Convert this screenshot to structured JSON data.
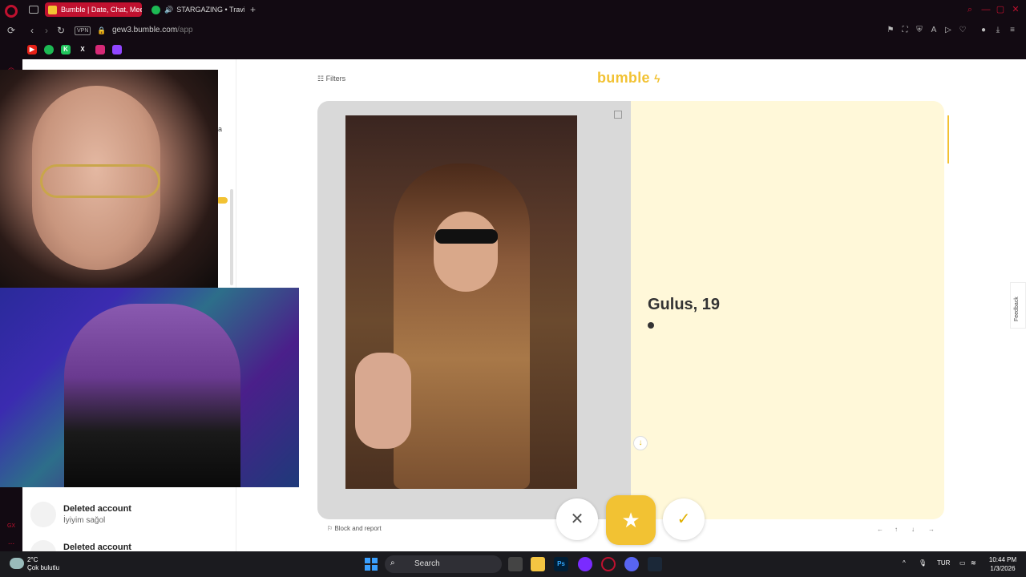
{
  "browser": {
    "tabs": [
      {
        "title": "Bumble | Date, Chat, Mee",
        "active": true
      },
      {
        "title": "STARGAZING • Travis",
        "active": false
      }
    ],
    "new_tab": "+",
    "vpn_label": "VPN",
    "url": {
      "host": "gew3.bumble.com",
      "path": "/app"
    },
    "bookmarks": [
      "youtube-icon",
      "spotify-icon",
      "kick-icon",
      "x-icon",
      "instagram-icon",
      "twitch-icon"
    ]
  },
  "opera_sidebar": {
    "icons": [
      "opera-logo-icon",
      "speed-dial-icon",
      "gx-icon",
      "more-icon"
    ],
    "gx_label": "GX",
    "more_label": "..."
  },
  "left_pane": {
    "matches": [
      {
        "name": "Deleted account",
        "message": "İyiyim sağol"
      },
      {
        "name": "Deleted account",
        "message": ""
      }
    ],
    "partial_text": "a"
  },
  "header": {
    "filters_label": "Filters",
    "logo": "bumble"
  },
  "profile": {
    "name_age": "Gulus, 19"
  },
  "card": {
    "report_label": "Block and report"
  },
  "actions": {
    "pass": "✕",
    "superswipe": "★",
    "like": "✓"
  },
  "keyboard_hints": [
    "←",
    "↑",
    "↓",
    "→"
  ],
  "feedback_label": "Feedback",
  "taskbar": {
    "weather": {
      "temp": "2°C",
      "condition": "Çok bulutlu"
    },
    "search_placeholder": "Search",
    "apps": [
      "file-explorer-icon",
      "folder-icon",
      "photoshop-icon",
      "arc-icon",
      "opera-gx-icon",
      "discord-icon",
      "steam-icon"
    ],
    "ps_label": "Ps",
    "tray": {
      "lang": "TUR"
    },
    "clock": {
      "time": "10:44 PM",
      "date": "1/3/2026"
    }
  },
  "colors": {
    "accent": "#f2c233",
    "opera": "#c0112f",
    "info_bg": "#fff8d9"
  }
}
